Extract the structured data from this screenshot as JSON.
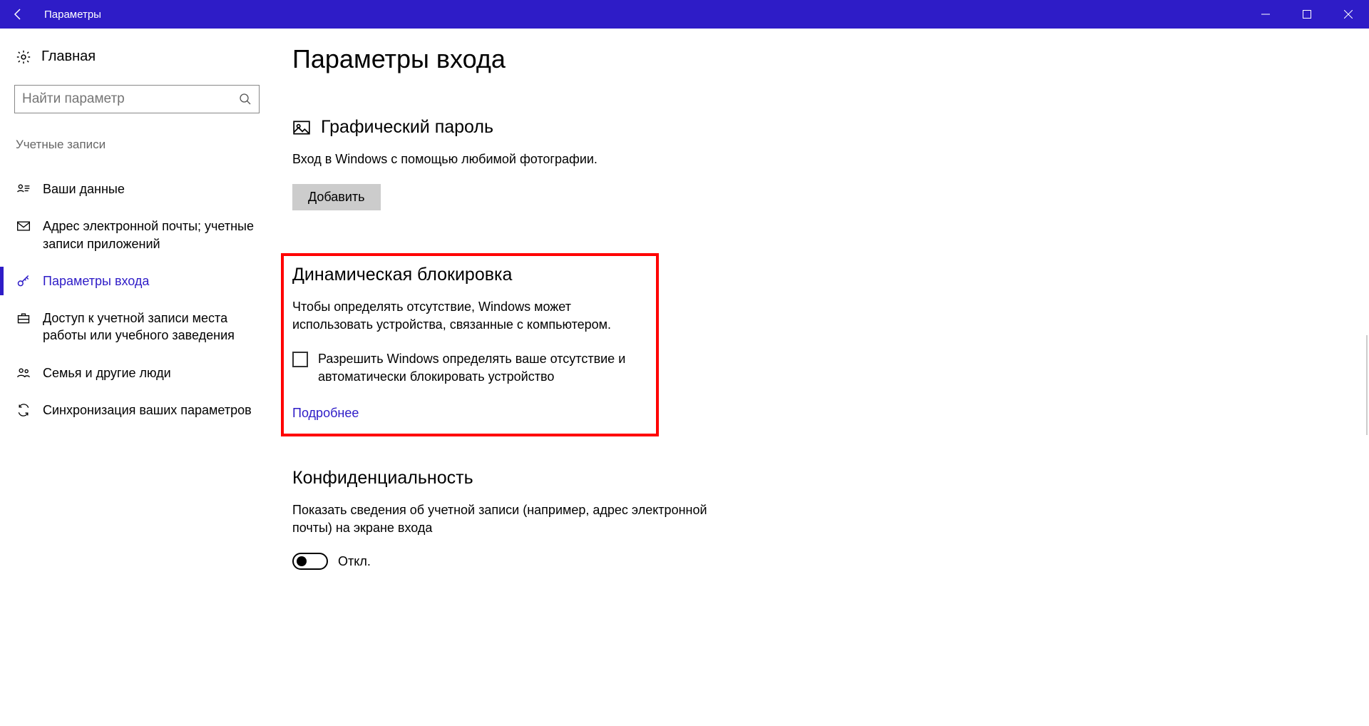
{
  "titlebar": {
    "title": "Параметры"
  },
  "sidebar": {
    "home": "Главная",
    "search_placeholder": "Найти параметр",
    "group": "Учетные записи",
    "items": [
      {
        "label": "Ваши данные"
      },
      {
        "label": "Адрес электронной почты; учетные записи приложений"
      },
      {
        "label": "Параметры входа"
      },
      {
        "label": "Доступ к учетной записи места работы или учебного заведения"
      },
      {
        "label": "Семья и другие люди"
      },
      {
        "label": "Синхронизация ваших параметров"
      }
    ]
  },
  "content": {
    "page_title": "Параметры входа",
    "picture_password": {
      "heading": "Графический пароль",
      "desc": "Вход в Windows с помощью любимой фотографии.",
      "button": "Добавить"
    },
    "dynamic_lock": {
      "heading": "Динамическая блокировка",
      "desc": "Чтобы определять отсутствие, Windows может использовать устройства, связанные с компьютером.",
      "checkbox_label": "Разрешить Windows определять ваше отсутствие и автоматически блокировать устройство",
      "learn_more": "Подробнее"
    },
    "privacy": {
      "heading": "Конфиденциальность",
      "desc": "Показать сведения об учетной записи (например, адрес электронной почты) на экране входа",
      "toggle_state": "Откл."
    }
  }
}
